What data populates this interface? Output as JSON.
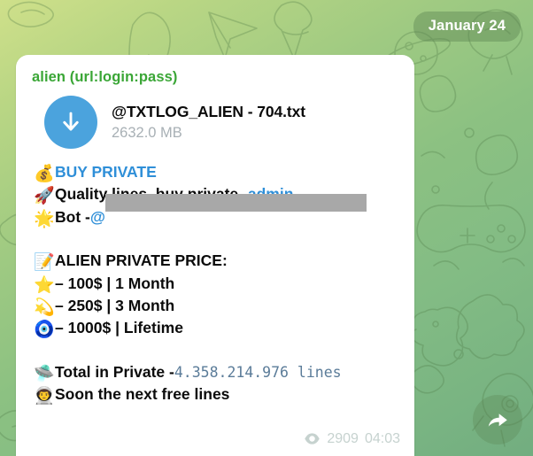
{
  "theme": {
    "bubble_bg": "#ffffff",
    "channel_title_color": "#3aa636",
    "link_color": "#2f8fd8",
    "download_circle_color": "#4ba3dd",
    "mono_count_color": "#5b7c99",
    "meta_color": "#c6d2cf",
    "redaction_color": "#a8a8a8"
  },
  "date_badge": {
    "label": "January 24"
  },
  "message": {
    "channel_title": "alien (url:login:pass)",
    "attachment": {
      "icon": "download-arrow-icon",
      "file_name": "@TXTLOG_ALIEN - 704.txt",
      "file_size": "2632.0 MB"
    },
    "lines": [
      {
        "emoji": "💰",
        "emoji_name": "money-bag-emoji",
        "text": "BUY PRIVATE",
        "style": "link-plain"
      },
      {
        "emoji": "🚀",
        "emoji_name": "rocket-emoji",
        "text_before": "Quality lines, buy private - ",
        "link_text": "admin"
      },
      {
        "emoji": "🌟",
        "emoji_name": "glowing-star-emoji",
        "text_before": "Bot - ",
        "at_symbol": "@",
        "redacted_handle": "redacted-bot-handle"
      },
      {
        "emoji": "📝",
        "emoji_name": "memo-emoji",
        "text": "ALIEN PRIVATE PRICE:"
      },
      {
        "emoji": "⭐",
        "emoji_name": "orange-star-emoji",
        "text": "– 100$ | 1 Month"
      },
      {
        "emoji": "💫",
        "emoji_name": "blue-star-emoji",
        "text": "– 250$ | 3 Month"
      },
      {
        "emoji": "🧿",
        "emoji_name": "eye-amulet-emoji",
        "text": "– 1000$ | Lifetime"
      },
      {
        "emoji": "🛸",
        "emoji_name": "ufo-emoji",
        "text_before": "Total in Private - ",
        "count_text": "4.358.214.976 lines"
      },
      {
        "emoji": "👨‍🚀",
        "emoji_name": "astronaut-emoji",
        "text": "Soon the next free lines"
      }
    ],
    "meta": {
      "views_icon": "eye-icon",
      "views": "2909",
      "time": "04:03"
    }
  },
  "share_button": {
    "icon": "forward-arrow-icon",
    "label": "Forward"
  }
}
